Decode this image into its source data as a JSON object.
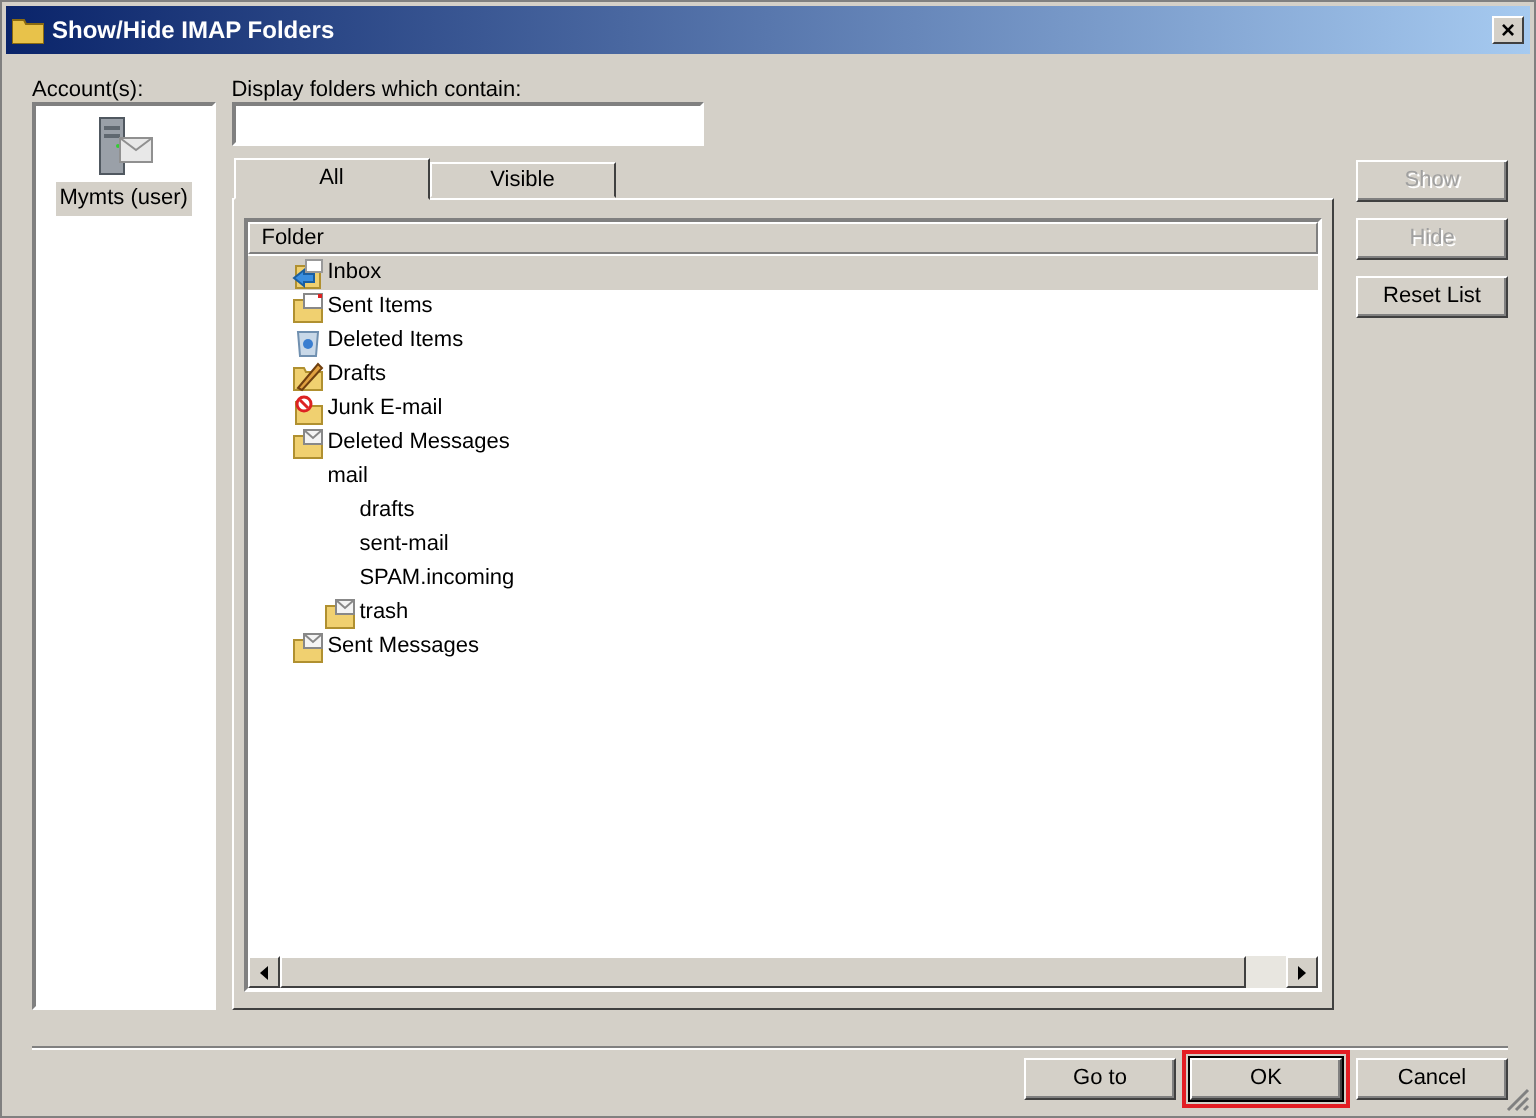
{
  "window": {
    "title": "Show/Hide IMAP Folders",
    "close": "×"
  },
  "accounts": {
    "label": "Account(s):",
    "items": [
      {
        "name": "Mymts (user)",
        "selected": true
      }
    ]
  },
  "filter": {
    "label": "Display folders which contain:"
  },
  "tabs": [
    {
      "label": "All",
      "selected": true
    },
    {
      "label": "Visible",
      "selected": false
    }
  ],
  "folder_list": {
    "column": "Folder",
    "items": [
      {
        "name": "Inbox",
        "kind": "inbox",
        "selected": true
      },
      {
        "name": "Sent Items",
        "kind": "sent",
        "selected": false
      },
      {
        "name": "Deleted Items",
        "kind": "recycle",
        "selected": false
      },
      {
        "name": "Drafts",
        "kind": "drafts",
        "selected": false
      },
      {
        "name": "Junk E-mail",
        "kind": "junk",
        "selected": false
      },
      {
        "name": "Deleted Messages",
        "kind": "mail",
        "selected": false
      },
      {
        "name": "mail",
        "kind": "plain",
        "selected": false,
        "children": [
          {
            "name": "drafts",
            "kind": "plain",
            "selected": false
          },
          {
            "name": "sent-mail",
            "kind": "plain",
            "selected": false
          },
          {
            "name": "SPAM.incoming",
            "kind": "plain",
            "selected": false
          },
          {
            "name": "trash",
            "kind": "mail",
            "selected": false
          }
        ]
      },
      {
        "name": "Sent Messages",
        "kind": "mail",
        "selected": false
      }
    ]
  },
  "side_buttons": [
    {
      "label": "Show",
      "disabled": true
    },
    {
      "label": "Hide",
      "disabled": true
    },
    {
      "label": "Reset List",
      "disabled": false
    }
  ],
  "bottom_buttons": [
    {
      "label": "Go to",
      "default": false,
      "highlighted": false
    },
    {
      "label": "OK",
      "default": true,
      "highlighted": true
    },
    {
      "label": "Cancel",
      "default": false,
      "highlighted": false
    }
  ]
}
